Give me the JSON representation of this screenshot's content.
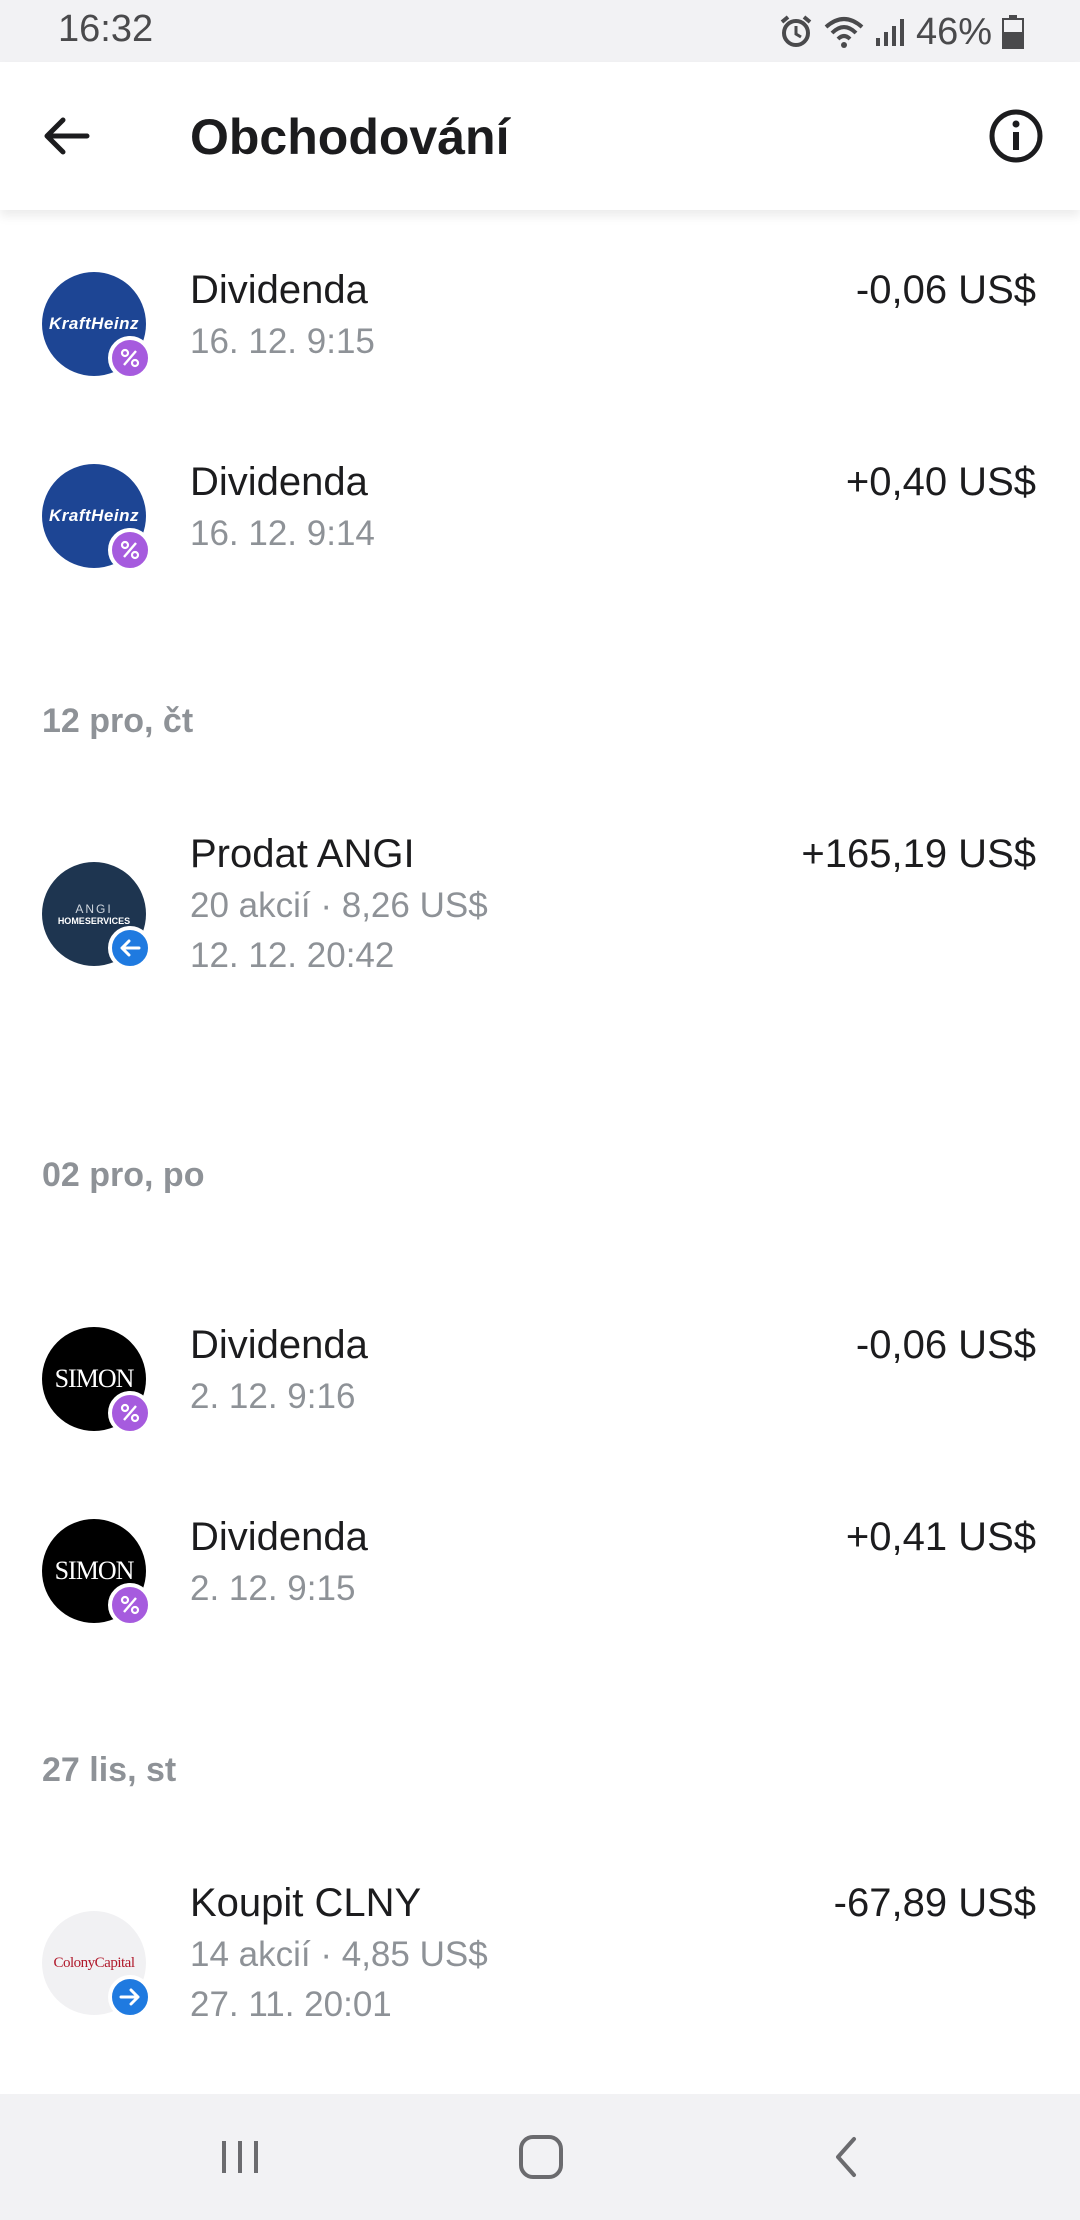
{
  "status_bar": {
    "time": "16:32",
    "battery": "46%",
    "icons": [
      "alarm-icon",
      "wifi-icon",
      "signal-icon",
      "battery-icon"
    ]
  },
  "header": {
    "title": "Obchodování",
    "back_icon": "arrow-left-icon",
    "info_icon": "info-icon"
  },
  "transactions": [
    {
      "company": "Kraft Heinz",
      "logo_text": "KraftHeinz",
      "logo_color": "#1d4594",
      "badge": "percent-icon",
      "label": "Dividenda",
      "date": "16. 12. 9:15",
      "amount": "-0,06 US$"
    },
    {
      "company": "Kraft Heinz",
      "logo_text": "KraftHeinz",
      "logo_color": "#1d4594",
      "badge": "percent-icon",
      "label": "Dividenda",
      "date": "16. 12. 9:14",
      "amount": "+0,40 US$"
    }
  ],
  "sections": [
    {
      "header": "12 pro, čt",
      "items": [
        {
          "logo_text_top": "ANGI",
          "logo_text_bottom": "HOMESERVICES",
          "logo_color": "#1e3550",
          "badge": "arrow-left-icon",
          "label": "Prodat ANGI",
          "detail": "20 akcií · 8,26 US$",
          "date": "12. 12. 20:42",
          "amount": "+165,19 US$"
        }
      ]
    },
    {
      "header": "02 pro, po",
      "items": [
        {
          "logo_text": "SIMON",
          "logo_color": "#000000",
          "badge": "percent-icon",
          "label": "Dividenda",
          "date": "2. 12. 9:16",
          "amount": "-0,06 US$"
        },
        {
          "logo_text": "SIMON",
          "logo_color": "#000000",
          "badge": "percent-icon",
          "label": "Dividenda",
          "date": "2. 12. 9:15",
          "amount": "+0,41 US$"
        }
      ]
    },
    {
      "header": "27 lis, st",
      "items": [
        {
          "logo_text": "ColonyCapital",
          "logo_color": "#f1f1f3",
          "badge": "arrow-right-icon",
          "label": "Koupit CLNY",
          "detail": "14 akcií · 4,85 US$",
          "date": "27. 11. 20:01",
          "amount": "-67,89 US$"
        }
      ]
    }
  ],
  "nav_bar": {
    "items": [
      "recents-icon",
      "home-icon",
      "back-icon"
    ]
  },
  "colors": {
    "accent_purple": "#a65bde",
    "accent_blue": "#1f7ae0",
    "secondary_text": "#8e9297"
  }
}
